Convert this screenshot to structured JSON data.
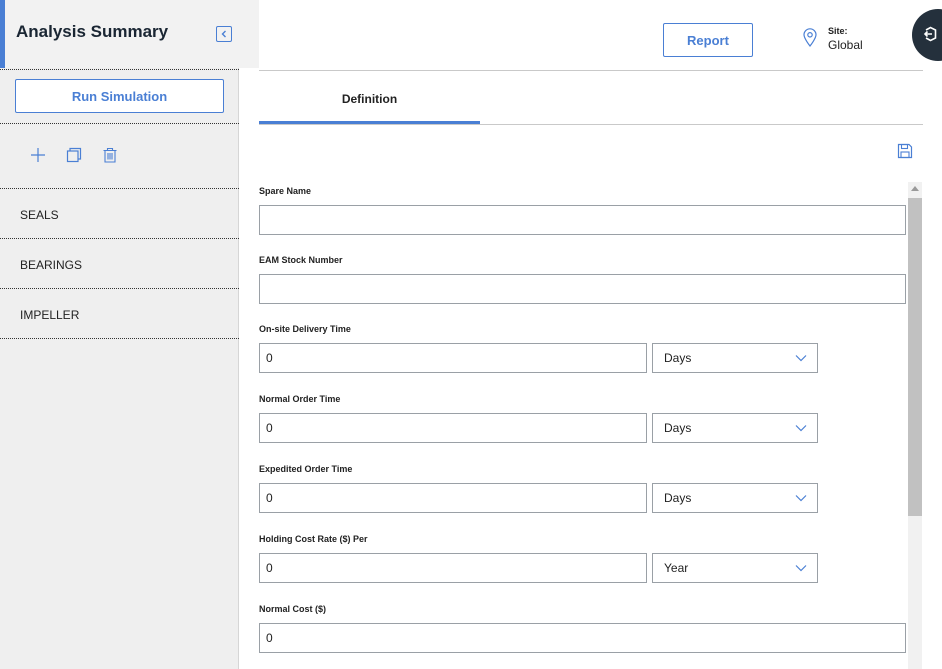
{
  "sidebar": {
    "title": "Analysis Summary",
    "run_simulation_label": "Run Simulation",
    "items": [
      {
        "label": "SEALS"
      },
      {
        "label": "BEARINGS"
      },
      {
        "label": "IMPELLER"
      }
    ]
  },
  "header": {
    "report_label": "Report",
    "site_label": "Site:",
    "site_value": "Global"
  },
  "tabs": [
    {
      "label": "Definition",
      "active": true
    }
  ],
  "form": {
    "spare_name": {
      "label": "Spare Name",
      "value": ""
    },
    "eam_stock_number": {
      "label": "EAM Stock Number",
      "value": ""
    },
    "onsite_delivery_time": {
      "label": "On-site Delivery Time",
      "value": "0",
      "unit": "Days"
    },
    "normal_order_time": {
      "label": "Normal Order Time",
      "value": "0",
      "unit": "Days"
    },
    "expedited_order_time": {
      "label": "Expedited Order Time",
      "value": "0",
      "unit": "Days"
    },
    "holding_cost_rate": {
      "label": "Holding Cost Rate ($) Per",
      "value": "0",
      "unit": "Year"
    },
    "normal_cost": {
      "label": "Normal Cost ($)",
      "value": "0"
    }
  },
  "colors": {
    "accent": "#4a7fd4",
    "sidebar_bg": "#efefef",
    "dark_button": "#24303c"
  },
  "icons": {
    "collapse": "chevron-left-icon",
    "add": "plus-icon",
    "copy": "copy-icon",
    "delete": "trash-icon",
    "site": "location-pin-icon",
    "save": "save-icon",
    "corner": "exit-icon",
    "dropdown": "chevron-down-icon"
  }
}
